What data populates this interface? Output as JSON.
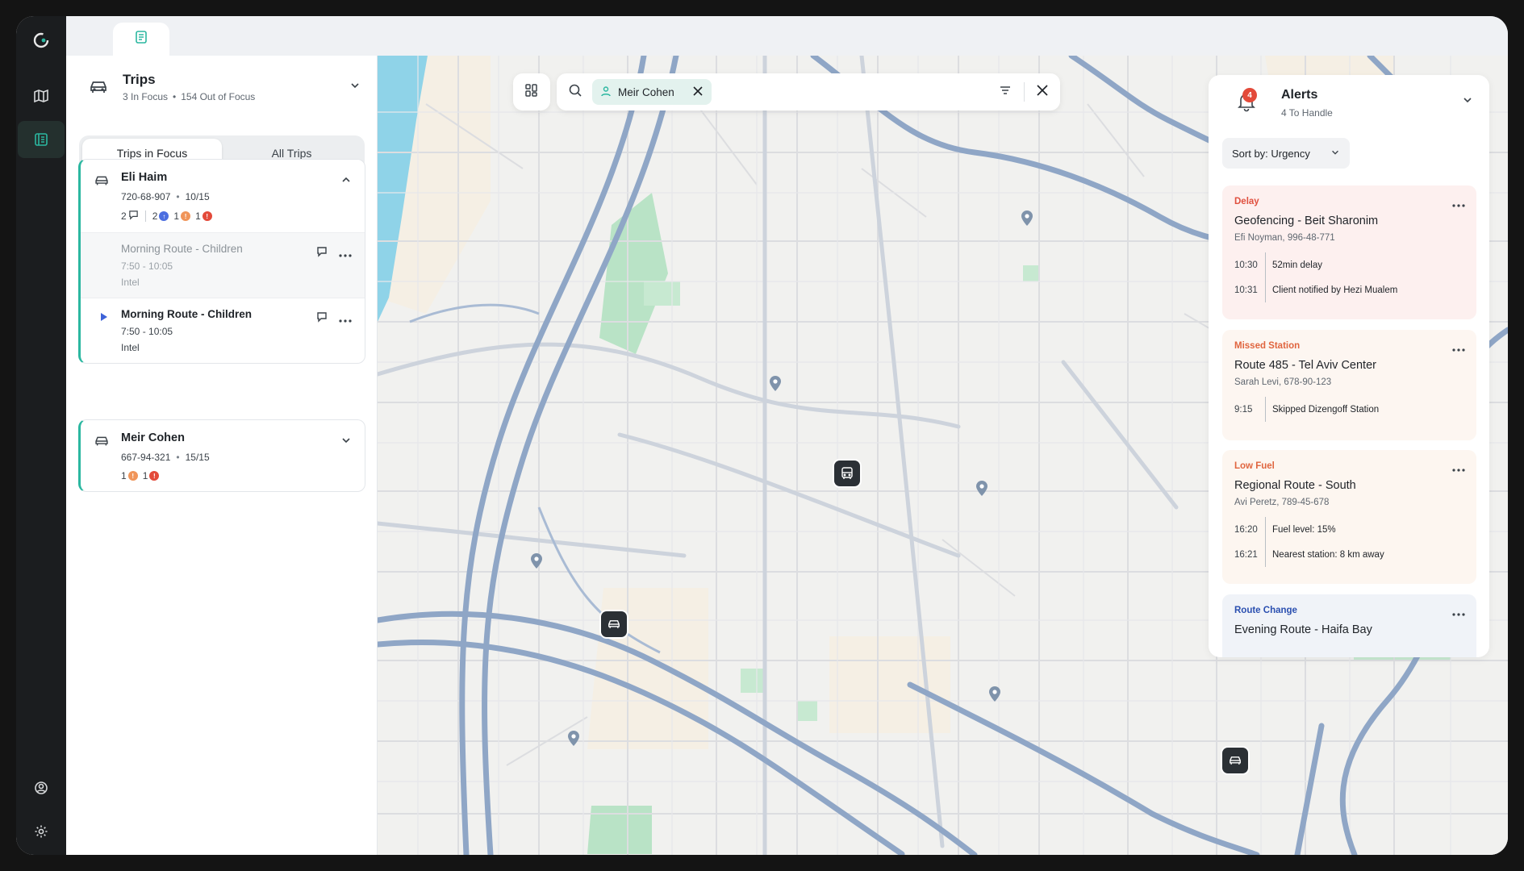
{
  "tabs": {
    "active_tab_icon": "notes-icon"
  },
  "rail": {
    "items": [
      "logo-icon",
      "map-icon",
      "trips-icon"
    ],
    "bottom": [
      "user-icon",
      "settings-icon"
    ]
  },
  "trips": {
    "title": "Trips",
    "in_focus": "3 In Focus",
    "out_of_focus": "154 Out of Focus",
    "segments": [
      "Trips in Focus",
      "All Trips"
    ],
    "cards": [
      {
        "name": "Eli Haim",
        "phone": "720-68-907",
        "progress": "10/15",
        "badges": {
          "messages": "2",
          "info": "2",
          "warn": "1",
          "error": "1"
        },
        "routes": [
          {
            "name": "Morning Route - Children",
            "time": "7:50 - 10:05",
            "location": "Intel",
            "active": false
          },
          {
            "name": "Morning Route - Children",
            "time": "7:50 - 10:05",
            "location": "Intel",
            "active": true
          }
        ]
      },
      {
        "name": "Meir Cohen",
        "phone": "667-94-321",
        "progress": "15/15",
        "badges": {
          "warn": "1",
          "error": "1"
        }
      }
    ]
  },
  "search": {
    "chip_label": "Meir Cohen"
  },
  "alerts": {
    "count": "4",
    "title": "Alerts",
    "subtitle": "4 To Handle",
    "sort_label": "Sort by: Urgency",
    "items": [
      {
        "type": "Delay",
        "title": "Geofencing - Beit Sharonim",
        "who": "Efi Noyman, 996-48-771",
        "events": [
          {
            "time": "10:30",
            "text": "52min delay"
          },
          {
            "time": "10:31",
            "text": "Client notified by Hezi Mualem"
          }
        ]
      },
      {
        "type": "Missed Station",
        "title": "Route 485 - Tel Aviv Center",
        "who": "Sarah Levi, 678-90-123",
        "events": [
          {
            "time": "9:15",
            "text": "Skipped Dizengoff Station"
          }
        ]
      },
      {
        "type": "Low Fuel",
        "title": "Regional Route - South",
        "who": "Avi Peretz, 789-45-678",
        "events": [
          {
            "time": "16:20",
            "text": "Fuel level: 15%"
          },
          {
            "time": "16:21",
            "text": "Nearest station: 8 km away"
          }
        ]
      },
      {
        "type": "Route Change",
        "title": "Evening Route - Haifa Bay"
      }
    ]
  },
  "colors": {
    "accent": "#2bb7a0",
    "rail": "#1b1d1f",
    "water": "#8fd3e8",
    "park": "#b9e3c6",
    "road_major": "#8fa6c6"
  }
}
